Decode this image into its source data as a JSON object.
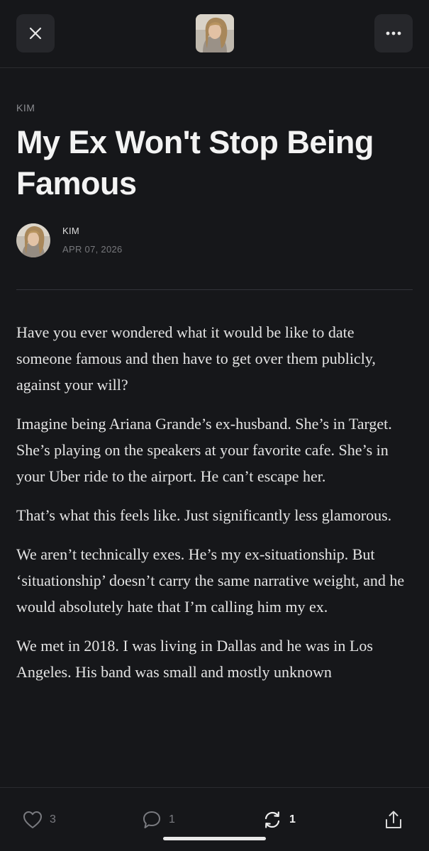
{
  "header": {
    "close_icon": "close-icon",
    "more_icon": "more-horizontal-icon",
    "publication_avatar": "publication-avatar-image"
  },
  "article": {
    "kicker": "KIM",
    "title": "My Ex Won't Stop Being Famous",
    "author": "KIM",
    "date": "APR 07, 2026",
    "paragraphs": [
      "Have you ever wondered what it would be like to date someone famous and then have to get over them publicly, against your will?",
      "Imagine being Ariana Grande’s ex-husband. She’s in Target. She’s playing on the speakers at your favorite cafe. She’s in your Uber ride to the airport. He can’t escape her.",
      "That’s what this feels like. Just significantly less glamorous.",
      "We aren’t technically exes. He’s my ex-situationship. But ‘situationship’ doesn’t carry the same narrative weight, and he would absolutely hate that I’m calling him my ex.",
      "We met in 2018. I was living in Dallas and he was in Los Angeles. His band was small and mostly unknown"
    ]
  },
  "actions": {
    "likes": "3",
    "comments": "1",
    "restacks": "1",
    "icons": [
      "heart-icon",
      "comment-icon",
      "restack-icon",
      "share-icon"
    ]
  },
  "colors": {
    "background": "#16171a",
    "button_bg": "#26272b",
    "text": "#ededed",
    "muted": "#7a7b80"
  }
}
